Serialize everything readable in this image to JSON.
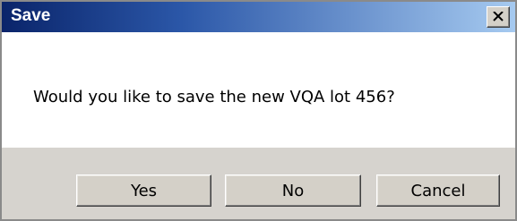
{
  "window": {
    "title": "Save"
  },
  "message": {
    "text": "Would you like to save the new VQA lot 456?"
  },
  "buttons": {
    "yes": "Yes",
    "no": "No",
    "cancel": "Cancel"
  },
  "icons": {
    "close": "close-icon"
  },
  "colors": {
    "titlebar_start": "#0a246a",
    "titlebar_end": "#a6caf0",
    "button_face": "#d4d0c8",
    "button_bar": "#d6d3ce"
  }
}
